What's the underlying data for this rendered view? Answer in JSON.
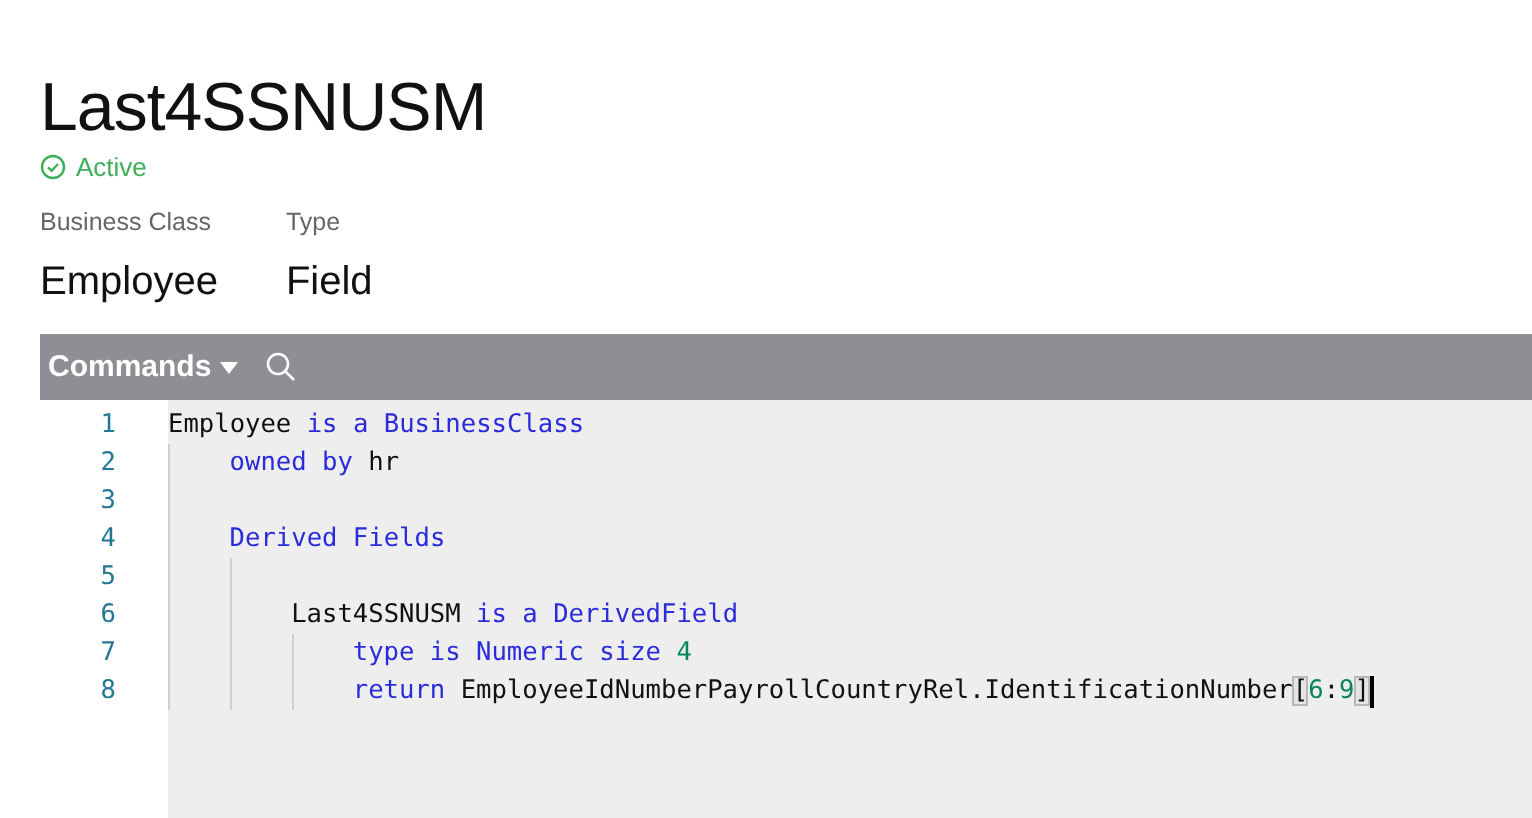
{
  "header": {
    "title": "Last4SSNUSM",
    "status": {
      "label": "Active",
      "active": true
    }
  },
  "properties": [
    {
      "label": "Business Class",
      "value": "Employee"
    },
    {
      "label": "Type",
      "value": "Field"
    }
  ],
  "toolbar": {
    "commands_label": "Commands"
  },
  "editor": {
    "lines": [
      {
        "number": "1",
        "tokens": [
          {
            "text": "Employee ",
            "kind": "plain"
          },
          {
            "text": "is a BusinessClass",
            "kind": "keyword"
          }
        ],
        "children": [
          {
            "number": "2",
            "tokens": [
              {
                "text": "owned by",
                "kind": "keyword"
              },
              {
                "text": " hr",
                "kind": "plain"
              }
            ]
          },
          {
            "number": "3"
          },
          {
            "number": "4",
            "tokens": [
              {
                "text": "Derived Fields",
                "kind": "keyword"
              }
            ],
            "children": [
              {
                "number": "5"
              },
              {
                "number": "6",
                "tokens": [
                  {
                    "text": "Last4SSNUSM ",
                    "kind": "plain"
                  },
                  {
                    "text": "is a DerivedField",
                    "kind": "keyword"
                  }
                ],
                "children": [
                  {
                    "number": "7",
                    "tokens": [
                      {
                        "text": "type is Numeric size ",
                        "kind": "keyword"
                      },
                      {
                        "text": "4",
                        "kind": "number"
                      }
                    ]
                  },
                  {
                    "number": "8",
                    "cursor": true,
                    "tokens": [
                      {
                        "text": "return",
                        "kind": "keyword"
                      },
                      {
                        "text": " EmployeeIdNumberPayrollCountryRel.IdentificationNumber",
                        "kind": "plain"
                      },
                      {
                        "text": "[",
                        "kind": "bracket"
                      },
                      {
                        "text": "6",
                        "kind": "number"
                      },
                      {
                        "text": ":",
                        "kind": "plain"
                      },
                      {
                        "text": "9",
                        "kind": "number"
                      },
                      {
                        "text": "]",
                        "kind": "bracket"
                      }
                    ]
                  }
                ]
              }
            ]
          }
        ]
      }
    ]
  }
}
